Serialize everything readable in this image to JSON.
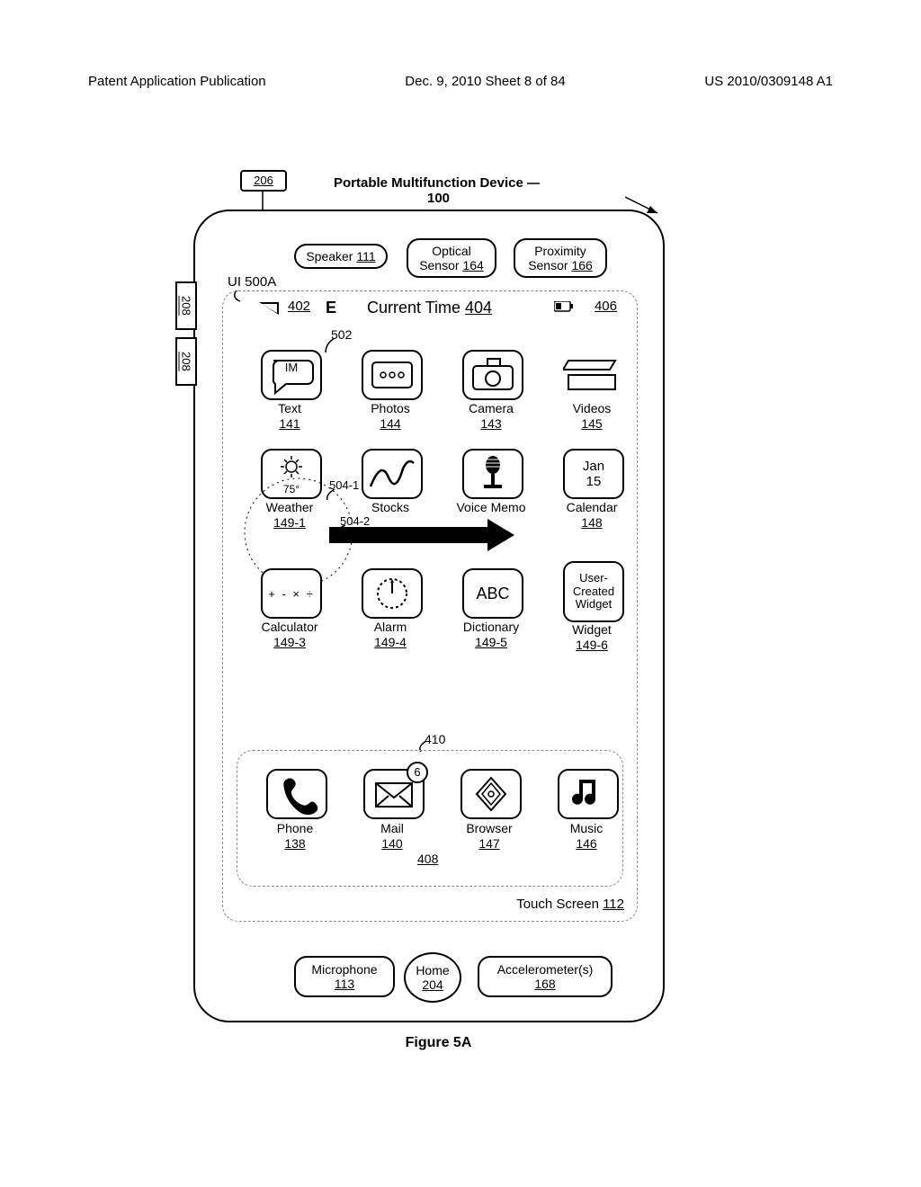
{
  "header": {
    "left": "Patent Application Publication",
    "center": "Dec. 9, 2010  Sheet 8 of 84",
    "right": "US 2010/0309148 A1"
  },
  "device_title_a": "Portable Multifunction Device",
  "device_title_b": "100",
  "ref_206": "206",
  "ref_208": "208",
  "ui_label": "UI 500A",
  "speaker": {
    "label": "Speaker ",
    "num": "111"
  },
  "optical": {
    "line1": "Optical",
    "line2": "Sensor ",
    "num": "164"
  },
  "proximity": {
    "line1": "Proximity",
    "line2": "Sensor ",
    "num": "166"
  },
  "status": {
    "ref402": "402",
    "E": "E",
    "ct": "Current Time ",
    "ref404": "404",
    "ref406": "406"
  },
  "callout_502": "502",
  "callout_504_1": "504-1",
  "callout_504_2": "504-2",
  "callout_410": "410",
  "callout_408": "408",
  "touch_label": "Touch Screen ",
  "touch_num": "112",
  "mic": {
    "label": "Microphone",
    "num": "113"
  },
  "home": {
    "label": "Home",
    "num": "204"
  },
  "accel": {
    "label": "Accelerometer(s)",
    "num": "168"
  },
  "apps": {
    "text": {
      "label": "Text",
      "num": "141",
      "inner": "IM"
    },
    "photos": {
      "label": "Photos",
      "num": "144"
    },
    "camera": {
      "label": "Camera",
      "num": "143"
    },
    "videos": {
      "label": "Videos",
      "num": "145"
    },
    "weather": {
      "label": "Weather",
      "num": "149-1",
      "inner": "75°"
    },
    "stocks": {
      "label": "Stocks"
    },
    "voice": {
      "label": "Voice Memo"
    },
    "calendar": {
      "label": "Calendar",
      "num": "148",
      "inner1": "Jan",
      "inner2": "15"
    },
    "calc": {
      "label": "Calculator",
      "num": "149-3",
      "inner": "+ - × ÷"
    },
    "alarm": {
      "label": "Alarm",
      "num": "149-4"
    },
    "dict": {
      "label": "Dictionary",
      "num": "149-5",
      "inner": "ABC"
    },
    "widget": {
      "label": "Widget",
      "num": "149-6",
      "inner1": "User-",
      "inner2": "Created",
      "inner3": "Widget"
    }
  },
  "dock": {
    "phone": {
      "label": "Phone",
      "num": "138"
    },
    "mail": {
      "label": "Mail",
      "num": "140",
      "badge": "6"
    },
    "browser": {
      "label": "Browser",
      "num": "147"
    },
    "music": {
      "label": "Music",
      "num": "146"
    }
  },
  "figure_caption": "Figure 5A"
}
